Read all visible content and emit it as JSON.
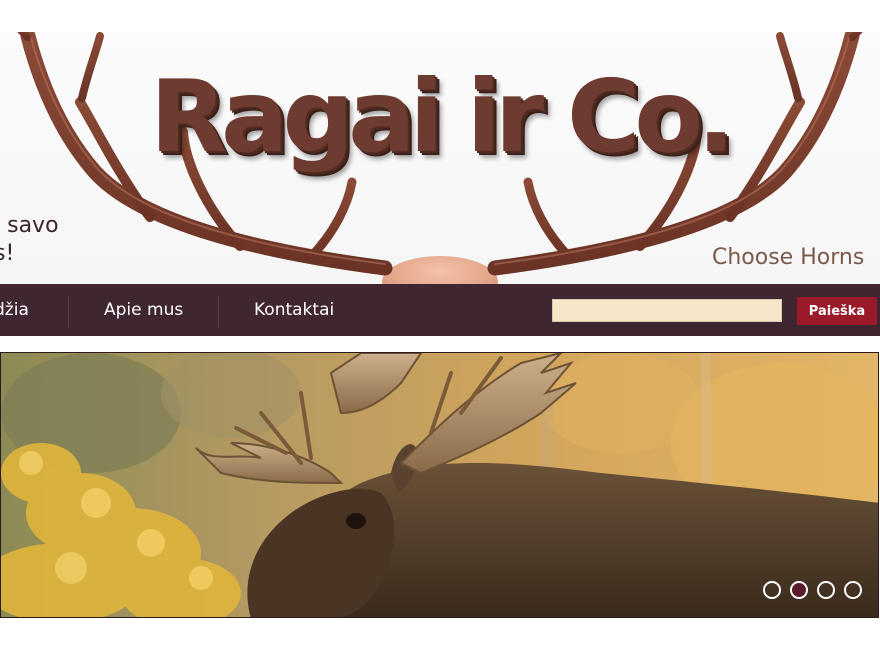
{
  "header": {
    "title": "Ragai ir Co.",
    "tagline_line1": "i savo",
    "tagline_line2": "s!",
    "slogan": "Choose Horns"
  },
  "nav": {
    "items": [
      {
        "label": "džia"
      },
      {
        "label": "Apie mus"
      },
      {
        "label": "Kontaktai"
      }
    ]
  },
  "search": {
    "value": "",
    "placeholder": "",
    "button_label": "Paieška"
  },
  "slider": {
    "total_slides": 4,
    "active_slide": 2,
    "image_subject": "moose"
  },
  "colors": {
    "title_brown": "#6d3b2f",
    "nav_bg": "#3f2630",
    "search_bg": "#f7e6c9",
    "search_button": "#9a1a2a",
    "active_dot": "#5a1a2a"
  },
  "icons": {
    "antlers": "antlers-icon",
    "slider_dot": "slider-dot-icon"
  }
}
